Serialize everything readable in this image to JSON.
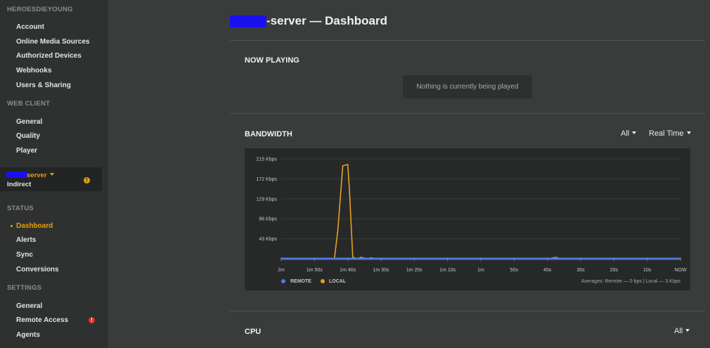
{
  "sidebar": {
    "account_header": "HEROESDIEYOUNG",
    "account_items": [
      "Account",
      "Online Media Sources",
      "Authorized Devices",
      "Webhooks",
      "Users & Sharing"
    ],
    "web_client_header": "WEB CLIENT",
    "web_client_items": [
      "General",
      "Quality",
      "Player"
    ],
    "server": {
      "name": "server",
      "connection": "Indirect",
      "warning_icon": "warning-circle-icon",
      "warning_color": "#e5a00d"
    },
    "status_header": "STATUS",
    "status_items": [
      "Dashboard",
      "Alerts",
      "Sync",
      "Conversions"
    ],
    "active_item": "Dashboard",
    "settings_header": "SETTINGS",
    "settings_items": [
      "General",
      "Remote Access",
      "Agents"
    ],
    "remote_access_badge_color": "#e0312c"
  },
  "main": {
    "title": "-server — Dashboard",
    "now_playing": {
      "header": "NOW PLAYING",
      "empty_message": "Nothing is currently being played"
    },
    "bandwidth": {
      "header": "BANDWIDTH",
      "filter_value": "All",
      "timeframe_value": "Real Time",
      "legend_remote": "REMOTE",
      "legend_local": "LOCAL",
      "averages": "Averages: Remote — 0 bps | Local — 3 Kbps"
    },
    "cpu": {
      "header": "CPU",
      "filter_value": "All"
    }
  },
  "colors": {
    "accent": "#e5a00d",
    "remote": "#4f7bd9",
    "local": "#e5a021",
    "redaction": "#1a10ee"
  },
  "chart_data": {
    "type": "line",
    "xlabel": "",
    "ylabel": "",
    "x_ticks": [
      "2m",
      "1m 50s",
      "1m 40s",
      "1m 30s",
      "1m 20s",
      "1m 10s",
      "1m",
      "50s",
      "40s",
      "30s",
      "20s",
      "10s",
      "NOW"
    ],
    "y_ticks": [
      "215 Kbps",
      "172 Kbps",
      "129 Kbps",
      "86 Kbps",
      "43 Kbps"
    ],
    "y_tick_values": [
      215,
      172,
      129,
      86,
      43
    ],
    "ylim": [
      0,
      215
    ],
    "xlim": [
      -120,
      0
    ],
    "grid": true,
    "legend_position": "bottom-left",
    "series": [
      {
        "name": "REMOTE",
        "x": [
          -120,
          0
        ],
        "values": [
          0,
          0
        ]
      },
      {
        "name": "LOCAL",
        "x": [
          -120,
          -105,
          -104,
          -103,
          -101.5,
          -100,
          -99.5,
          -98.5,
          -97,
          -96,
          -94,
          -93,
          -91,
          -89,
          -86,
          -80,
          -60,
          -45,
          -40,
          -37.5,
          -36,
          -30,
          -15,
          0
        ],
        "values": [
          0,
          0,
          0,
          60,
          200,
          203,
          150,
          3,
          0,
          3,
          0,
          2,
          0,
          1,
          0,
          0,
          0,
          0,
          0,
          3,
          0,
          0,
          0,
          0
        ]
      }
    ]
  }
}
